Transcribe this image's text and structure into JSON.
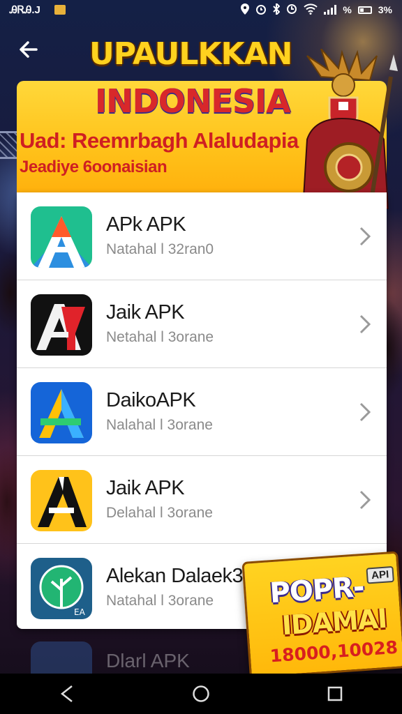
{
  "status_bar": {
    "left_text": "ᎯᏒᎯ.J",
    "right_text": "3%"
  },
  "header": {
    "back_label": "←",
    "headline": "UPAULKKAN"
  },
  "banner": {
    "title": "INDONESIA",
    "subtitle": "Uad: Reemrbagh Alaludapia",
    "subtitle2": "Jeadiye 6oonaisian"
  },
  "apps": [
    {
      "name": "APk APK",
      "sub": "Natahal l 32ran0",
      "icon": "apk-a-icon"
    },
    {
      "name": "Jaik APK",
      "sub": "Netahal l 3orane",
      "icon": "apk-ay-icon"
    },
    {
      "name": "DaikoAPK",
      "sub": "Nalahal l 3orane",
      "icon": "apk-blue-a-icon"
    },
    {
      "name": "Jaik APK",
      "sub": "Delahal l 3orane",
      "icon": "apk-yellow-a-icon"
    },
    {
      "name": "Alekan Dalaek3",
      "sub": "Natahal l 3orane",
      "icon": "leaf-app-icon"
    }
  ],
  "ghost_row": {
    "name": "Dlarl APK"
  },
  "promo": {
    "title": "POPR-",
    "tag": "API",
    "line2": "IDAMAI",
    "number": "18000,10028"
  },
  "colors": {
    "banner_yellow": "#ffc21a",
    "title_red": "#d8282a",
    "headline_yellow": "#ffd21f"
  }
}
